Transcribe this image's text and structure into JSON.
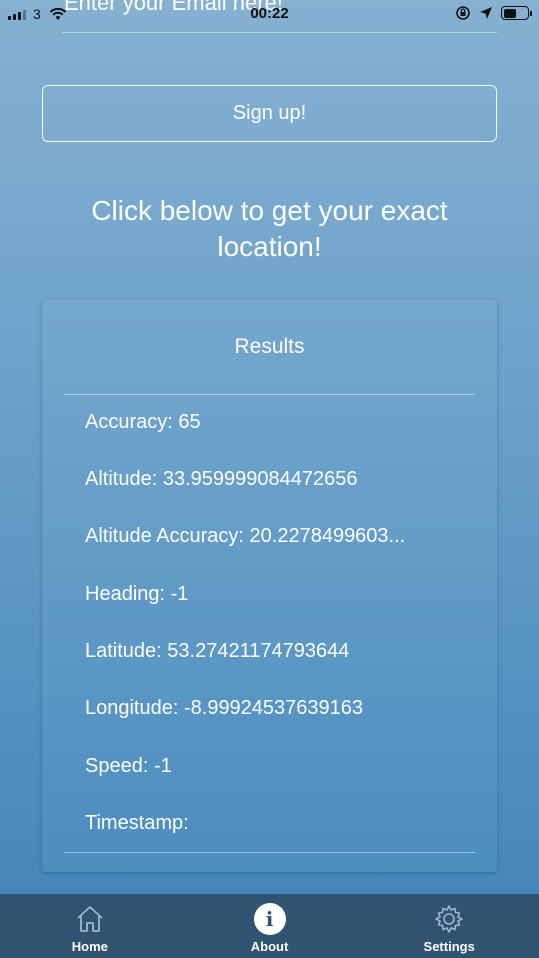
{
  "status_bar": {
    "carrier": "3",
    "time": "00:22"
  },
  "email_field": {
    "placeholder_text": "Enter your Email here!"
  },
  "signup": {
    "label": "Sign up!"
  },
  "prompt": {
    "title": "Click below to get your exact location!"
  },
  "results": {
    "header": "Results",
    "rows": [
      "Accuracy: 65",
      "Altitude: 33.959999084472656",
      "Altitude Accuracy: 20.2278499603...",
      "Heading: -1",
      "Latitude: 53.27421174793644",
      "Longitude: -8.99924537639163",
      "Speed: -1",
      "Timestamp:"
    ]
  },
  "tab_bar": {
    "tabs": [
      {
        "label": "Home",
        "icon": "home-icon",
        "active": false
      },
      {
        "label": "About",
        "icon": "info-icon",
        "active": true
      },
      {
        "label": "Settings",
        "icon": "gear-icon",
        "active": false
      }
    ]
  },
  "colors": {
    "tab_bar_bg": "#2f5371",
    "gradient_top": "#86b1d1",
    "gradient_bottom": "#4283b7"
  }
}
